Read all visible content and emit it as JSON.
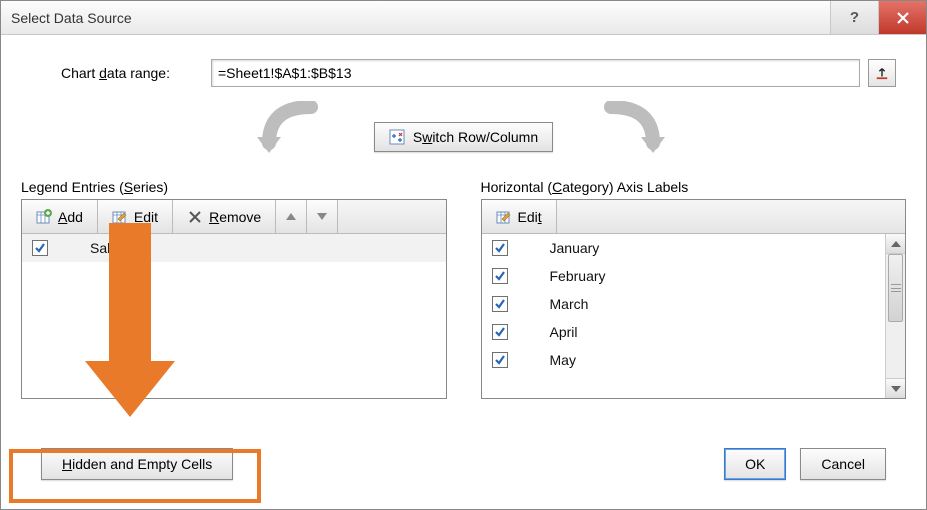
{
  "title": "Select Data Source",
  "range": {
    "label_prefix": "Chart ",
    "label_underline": "d",
    "label_suffix": "ata range:",
    "value": "=Sheet1!$A$1:$B$13"
  },
  "switch": {
    "prefix": "S",
    "underline": "w",
    "suffix": "itch Row/Column"
  },
  "left": {
    "label_prefix": "Legend Entries (",
    "label_underline": "S",
    "label_suffix": "eries)",
    "add": {
      "underline": "A",
      "suffix": "dd"
    },
    "edit": {
      "underline": "E",
      "suffix": "dit"
    },
    "remove": {
      "underline": "R",
      "suffix": "emove"
    },
    "items": [
      {
        "label": "Sales"
      }
    ]
  },
  "right": {
    "label_prefix": "Horizontal (",
    "label_underline": "C",
    "label_suffix": "ategory) Axis Labels",
    "edit": {
      "prefix": "Edi",
      "underline": "t"
    },
    "items": [
      {
        "label": "January"
      },
      {
        "label": "February"
      },
      {
        "label": "March"
      },
      {
        "label": "April"
      },
      {
        "label": "May"
      }
    ]
  },
  "footer": {
    "hidden": {
      "underline": "H",
      "suffix": "idden and Empty Cells"
    },
    "ok": "OK",
    "cancel": "Cancel"
  }
}
